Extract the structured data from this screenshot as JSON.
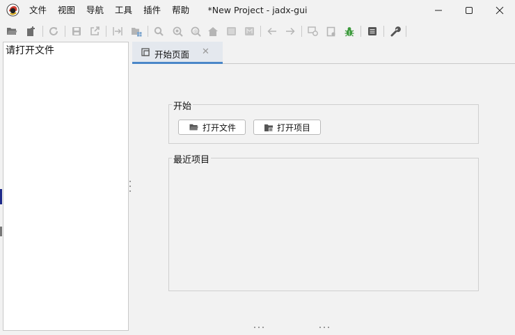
{
  "window": {
    "title": "*New Project - jadx-gui"
  },
  "menu": {
    "items": [
      "文件",
      "视图",
      "导航",
      "工具",
      "插件",
      "帮助"
    ]
  },
  "toolbar": {
    "buttons": [
      {
        "icon": "open-folder-icon",
        "enabled": true
      },
      {
        "icon": "add-files-icon",
        "enabled": true
      },
      {
        "icon": "reload-icon",
        "enabled": false
      },
      {
        "icon": "save-all-icon",
        "enabled": false
      },
      {
        "icon": "export-icon",
        "enabled": false
      },
      {
        "icon": "sync-tree-icon",
        "enabled": false
      },
      {
        "icon": "flatten-packages-icon",
        "enabled": false
      },
      {
        "icon": "search-icon",
        "enabled": false
      },
      {
        "icon": "find-class-icon",
        "enabled": false
      },
      {
        "icon": "find-usage-icon",
        "enabled": false
      },
      {
        "icon": "home-icon",
        "enabled": false
      },
      {
        "icon": "code-view-icon",
        "enabled": false
      },
      {
        "icon": "smali-view-icon",
        "enabled": false
      },
      {
        "icon": "back-arrow-icon",
        "enabled": false
      },
      {
        "icon": "forward-arrow-icon",
        "enabled": false
      },
      {
        "icon": "quark-icon",
        "enabled": false
      },
      {
        "icon": "decompile-all-icon",
        "enabled": false
      },
      {
        "icon": "debugger-bug-icon",
        "enabled": true
      },
      {
        "icon": "log-viewer-icon",
        "enabled": true
      },
      {
        "icon": "preferences-wrench-icon",
        "enabled": true
      }
    ]
  },
  "tree": {
    "placeholder": "请打开文件"
  },
  "tabs": [
    {
      "label": "开始页面",
      "active": true
    }
  ],
  "start_page": {
    "start_group": {
      "title": "开始",
      "open_file_label": "打开文件",
      "open_project_label": "打开项目"
    },
    "recent_group": {
      "title": "最近项目",
      "items": []
    }
  },
  "colors": {
    "window_bg": "#f2f2f2",
    "tab_underline": "#4a86c8",
    "debug_icon": "#3c9a3c",
    "icon_gray": "#6e6e6e",
    "icon_disabled": "#b5b5b5"
  }
}
